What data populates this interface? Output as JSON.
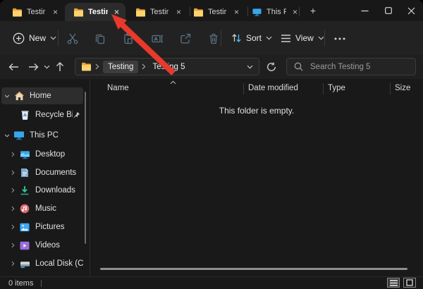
{
  "tabs": {
    "items": [
      {
        "label": "Testir",
        "active": false
      },
      {
        "label": "Testir",
        "active": true
      },
      {
        "label": "Testir",
        "active": false
      },
      {
        "label": "Testir",
        "active": false
      },
      {
        "label": "This P",
        "active": false
      }
    ],
    "close_glyph": "×",
    "new_tab_label": "+"
  },
  "toolbar": {
    "new_label": "New",
    "sort_label": "Sort",
    "view_label": "View"
  },
  "address": {
    "crumb_1": "Testing",
    "crumb_2": "Testing 5",
    "search_placeholder": "Search Testing 5"
  },
  "sidebar": {
    "items": [
      {
        "label": "Home"
      },
      {
        "label": "Recycle Bin"
      },
      {
        "label": "This PC"
      },
      {
        "label": "Desktop"
      },
      {
        "label": "Documents"
      },
      {
        "label": "Downloads"
      },
      {
        "label": "Music"
      },
      {
        "label": "Pictures"
      },
      {
        "label": "Videos"
      },
      {
        "label": "Local Disk (C:)"
      }
    ]
  },
  "main": {
    "columns": {
      "name": "Name",
      "date": "Date modified",
      "type": "Type",
      "size": "Size"
    },
    "empty_message": "This folder is empty."
  },
  "status": {
    "items_count": "0 items"
  },
  "colors": {
    "accent": "#4cc2ff",
    "arrow_red": "#e8392b",
    "folder_yellow": "#ffd36e",
    "disabled_icon": "#5c7282"
  }
}
